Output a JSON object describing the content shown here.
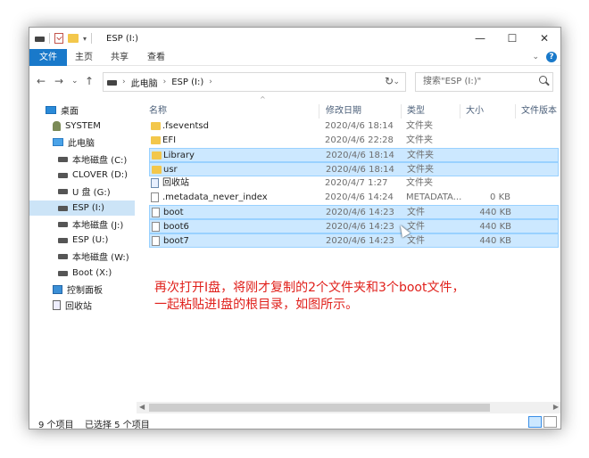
{
  "window": {
    "title": "ESP (I:)",
    "controls": {
      "minimize": "—",
      "maximize": "☐",
      "close": "✕"
    }
  },
  "ribbon": {
    "tabs": [
      "文件",
      "主页",
      "共享",
      "查看"
    ]
  },
  "address": {
    "path": [
      "此电脑",
      "ESP (I:)"
    ],
    "search_placeholder": "搜索\"ESP (I:)\""
  },
  "nav": {
    "items": [
      {
        "label": "桌面",
        "icon": "desktop-icon"
      },
      {
        "label": "SYSTEM",
        "icon": "user-icon"
      },
      {
        "label": "此电脑",
        "icon": "pc-icon"
      },
      {
        "label": "本地磁盘 (C:)",
        "icon": "drive-icon"
      },
      {
        "label": "CLOVER (D:)",
        "icon": "drive-icon"
      },
      {
        "label": "U 盘 (G:)",
        "icon": "drive-icon"
      },
      {
        "label": "ESP (I:)",
        "icon": "drive-icon",
        "selected": true
      },
      {
        "label": "本地磁盘 (J:)",
        "icon": "drive-icon"
      },
      {
        "label": "ESP (U:)",
        "icon": "drive-icon"
      },
      {
        "label": "本地磁盘 (W:)",
        "icon": "drive-icon"
      },
      {
        "label": "Boot (X:)",
        "icon": "drive-icon"
      },
      {
        "label": "控制面板",
        "icon": "control-panel-icon"
      },
      {
        "label": "回收站",
        "icon": "recycle-bin-icon"
      }
    ]
  },
  "columns": {
    "name": "名称",
    "date": "修改日期",
    "type": "类型",
    "size": "大小",
    "version": "文件版本"
  },
  "files": [
    {
      "name": ".fseventsd",
      "date": "2020/4/6 18:14",
      "type": "文件夹",
      "size": "",
      "icon": "folder-icon",
      "selected": false
    },
    {
      "name": "EFI",
      "date": "2020/4/6 22:28",
      "type": "文件夹",
      "size": "",
      "icon": "folder-icon",
      "selected": false
    },
    {
      "name": "Library",
      "date": "2020/4/6 18:14",
      "type": "文件夹",
      "size": "",
      "icon": "folder-icon",
      "selected": true
    },
    {
      "name": "usr",
      "date": "2020/4/6 18:14",
      "type": "文件夹",
      "size": "",
      "icon": "folder-icon",
      "selected": true
    },
    {
      "name": "回收站",
      "date": "2020/4/7 1:27",
      "type": "文件夹",
      "size": "",
      "icon": "recycle-bin-icon",
      "selected": false
    },
    {
      "name": ".metadata_never_index",
      "date": "2020/4/6 14:24",
      "type": "METADATA...",
      "size": "0 KB",
      "icon": "file-icon",
      "selected": false
    },
    {
      "name": "boot",
      "date": "2020/4/6 14:23",
      "type": "文件",
      "size": "440 KB",
      "icon": "file-icon",
      "selected": true
    },
    {
      "name": "boot6",
      "date": "2020/4/6 14:23",
      "type": "文件",
      "size": "440 KB",
      "icon": "file-icon",
      "selected": true
    },
    {
      "name": "boot7",
      "date": "2020/4/6 14:23",
      "type": "文件",
      "size": "440 KB",
      "icon": "file-icon",
      "selected": true
    }
  ],
  "annotation": {
    "line1": "再次打开I盘，将刚才复制的2个文件夹和3个boot文件，",
    "line2": "一起粘贴进I盘的根目录，如图所示。"
  },
  "status": {
    "count": "9 个项目",
    "selected": "已选择 5 个项目"
  }
}
